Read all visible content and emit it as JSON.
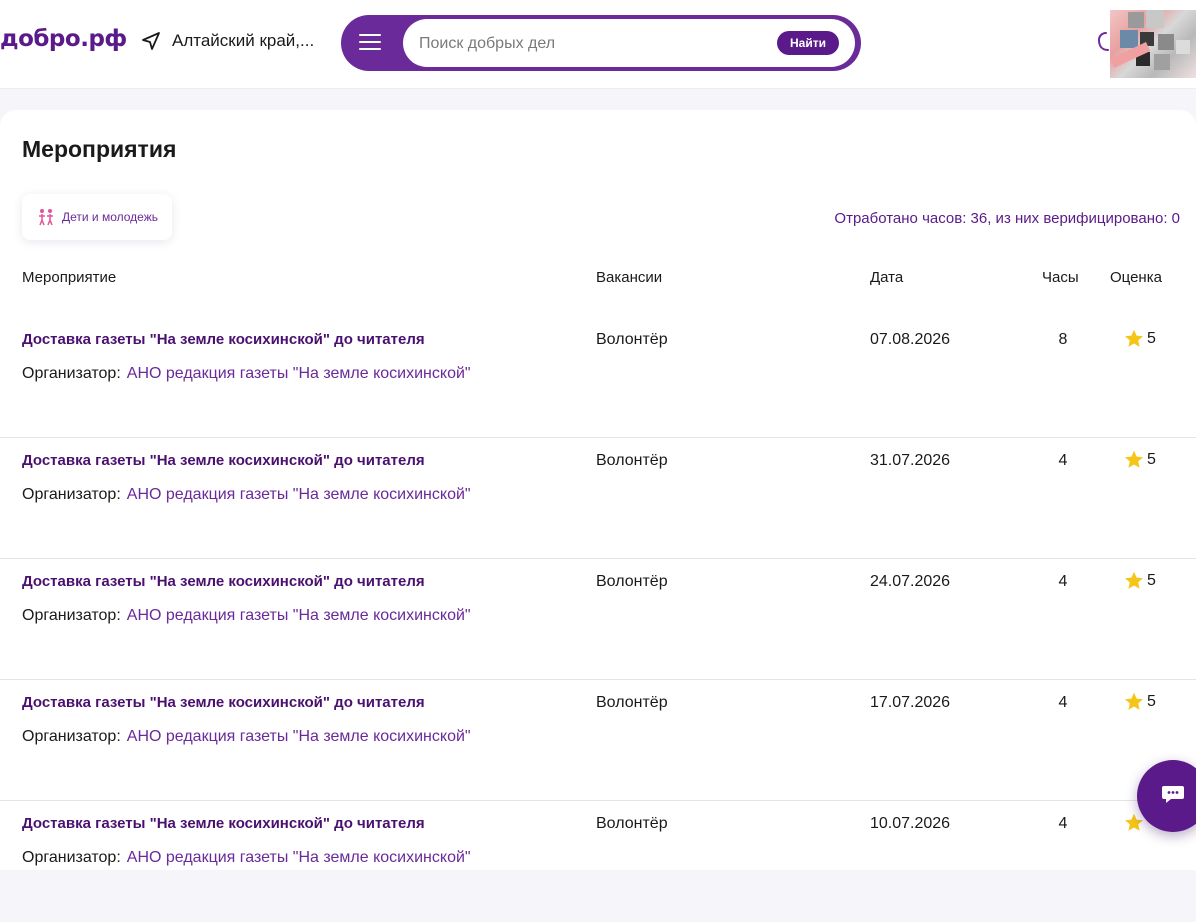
{
  "header": {
    "logo": "добро.рф",
    "region": "Алтайский край,...",
    "search": {
      "placeholder": "Поиск добрых дел",
      "button": "Найти"
    }
  },
  "main": {
    "title": "Мероприятия",
    "tag": "Дети и молодежь",
    "hours_summary": "Отработано часов: 36, из них верифицировано: 0",
    "columns": [
      "Мероприятие",
      "Вакансии",
      "Дата",
      "Часы",
      "Оценка"
    ],
    "organizer_label": "Организатор:",
    "rows": [
      {
        "title": "Доставка газеты \"На земле косихинской\" до читателя",
        "organizer": "АНО редакция газеты \"На земле косихинской\"",
        "vacancy": "Волонтёр",
        "date": "07.08.2026",
        "hours": "8",
        "rating": "5"
      },
      {
        "title": "Доставка газеты \"На земле косихинской\" до читателя",
        "organizer": "АНО редакция газеты \"На земле косихинской\"",
        "vacancy": "Волонтёр",
        "date": "31.07.2026",
        "hours": "4",
        "rating": "5"
      },
      {
        "title": "Доставка газеты \"На земле косихинской\" до читателя",
        "organizer": "АНО редакция газеты \"На земле косихинской\"",
        "vacancy": "Волонтёр",
        "date": "24.07.2026",
        "hours": "4",
        "rating": "5"
      },
      {
        "title": "Доставка газеты \"На земле косихинской\" до читателя",
        "organizer": "АНО редакция газеты \"На земле косихинской\"",
        "vacancy": "Волонтёр",
        "date": "17.07.2026",
        "hours": "4",
        "rating": "5"
      },
      {
        "title": "Доставка газеты \"На земле косихинской\" до читателя",
        "organizer": "АНО редакция газеты \"На земле косихинской\"",
        "vacancy": "Волонтёр",
        "date": "10.07.2026",
        "hours": "4",
        "rating": ""
      }
    ]
  },
  "icons": {
    "region": "location-arrow-icon",
    "menu": "menu-icon",
    "notifications": "bell-icon",
    "tag": "children-icon",
    "rating": "star-icon",
    "chat": "chat-icon"
  },
  "colors": {
    "brand": "#5a1a8a",
    "accent": "#f07a3a",
    "star": "#f5c518"
  }
}
